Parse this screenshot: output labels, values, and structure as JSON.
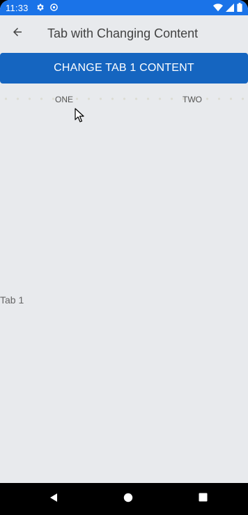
{
  "status_bar": {
    "time": "11:33",
    "left_icons": [
      "settings-icon",
      "data-saver-icon"
    ],
    "right_icons": [
      "wifi-icon",
      "cellular-signal-icon",
      "battery-icon"
    ],
    "color": "#1a73e8"
  },
  "app_bar": {
    "back_icon": "arrow-back-icon",
    "title": "Tab with Changing Content"
  },
  "change_button": {
    "label": "CHANGE TAB 1 CONTENT",
    "color": "#1565c0"
  },
  "tabs": [
    {
      "label": "ONE",
      "selected": true
    },
    {
      "label": "TWO",
      "selected": false
    }
  ],
  "content": {
    "text": "Tab 1"
  },
  "nav_bar": {
    "icons": [
      "nav-back-icon",
      "nav-home-icon",
      "nav-recents-icon"
    ]
  }
}
